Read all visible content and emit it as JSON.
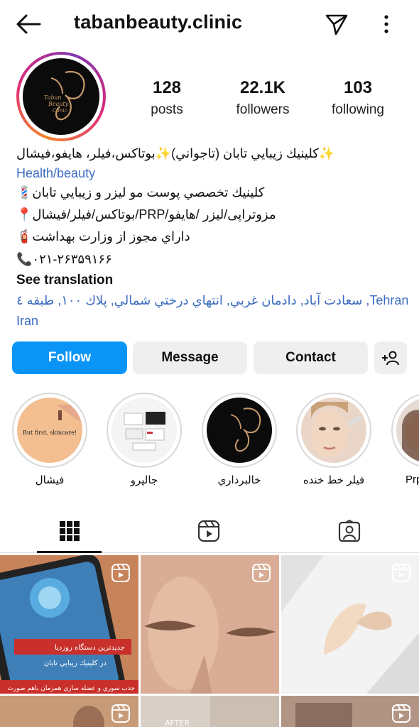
{
  "header": {
    "username": "tabanbeauty.clinic"
  },
  "stats": [
    {
      "value": "128",
      "label": "posts"
    },
    {
      "value": "22.1K",
      "label": "followers"
    },
    {
      "value": "103",
      "label": "following"
    }
  ],
  "bio": {
    "line1": "✨كلينيك زيبايي تابان (تاجواني)✨بوتاكس،فيلر، هايفو،فيشال",
    "category": "Health/beauty",
    "line2": "كلينيك تخصصي پوست مو ليزر و زيبايي تابان💈",
    "line3": "مزوتراپی/لیزر /هایفو/PRP/بوتاکس/فیلر/فیشال📍",
    "line4": "داراي مجوز از وزارت بهداشت🧯",
    "phone": "📞۰۲۱-۲۶۳۵۹۱۶۶",
    "see_translation": "See translation",
    "address_line1": "Tehran, سعادت آباد, دادمان غربي, انتهاي درختي شمالي, پلاك ۱۰۰, طبقه ٤",
    "address_line2": "Iran"
  },
  "actions": {
    "follow": "Follow",
    "message": "Message",
    "contact": "Contact"
  },
  "highlights": [
    {
      "label": "فيشال",
      "text": "But first, skincare!"
    },
    {
      "label": "جالپرو"
    },
    {
      "label": "خالبرداري"
    },
    {
      "label": "فيلر خط خنده"
    },
    {
      "label": "Prp"
    }
  ],
  "avatar_text": {
    "l1": "Taban",
    "l2": "Beauty",
    "l3": "Clinic"
  },
  "posts": [
    {
      "caption1": "جديدترين دستگاه روزديا",
      "caption2": "در كلينيك زيبايي تابان",
      "caption3": "جذب سوري و عضله سازي همزمان باهم صورت"
    },
    {
      "caption1": ""
    },
    {
      "caption1": ""
    },
    {
      "caption1": ""
    },
    {
      "caption1": "AFTER"
    },
    {
      "caption1": ""
    }
  ],
  "colors": {
    "accent": "#0a95f6",
    "link": "#3b6cc0",
    "gold": "#c79a6a"
  }
}
